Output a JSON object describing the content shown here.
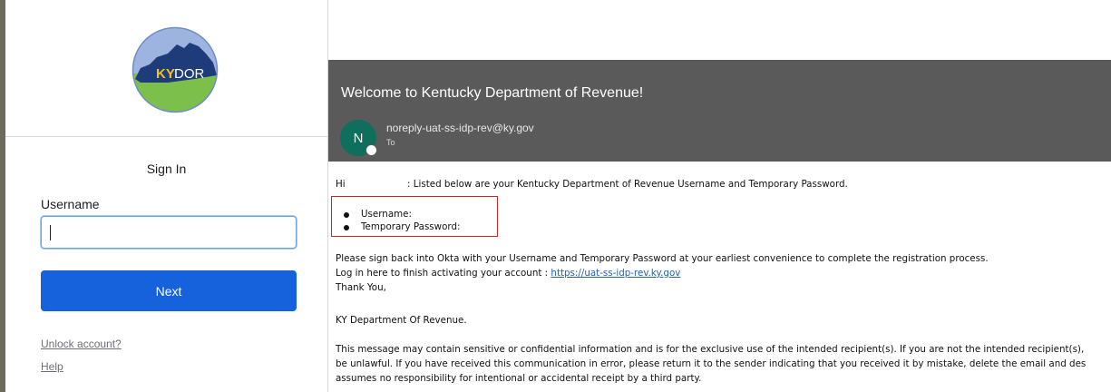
{
  "signin": {
    "logo_text_ky": "KY",
    "logo_text_dor": "DOR",
    "title": "Sign In",
    "username_label": "Username",
    "username_value": "",
    "next_label": "Next",
    "unlock_label": "Unlock account?",
    "help_label": "Help"
  },
  "email": {
    "subject": "Welcome to Kentucky Department of Revenue!",
    "avatar_letter": "N",
    "sender": "noreply-uat-ss-idp-rev@ky.gov",
    "to_label": "To",
    "greeting_hi": "Hi",
    "greeting_text": ": Listed below are your Kentucky Department of Revenue Username and Temporary Password.",
    "credentials": [
      "Username:",
      "Temporary Password:"
    ],
    "para_1": "Please sign back into Okta with your Username and Temporary Password at your earliest convenience to complete the registration process.",
    "para_2_prefix": "Log in here to finish activating your account : ",
    "para_2_link": "https://uat-ss-idp-rev.ky.gov",
    "thanks": "Thank You,",
    "signature": "KY Department Of Revenue.",
    "disclaimer_1": "This message may contain sensitive or confidential information and is for the exclusive use of the intended recipient(s). If you are not the intended recipient(s),",
    "disclaimer_2": "be unlawful. If you have received this communication in error, please return it to the sender indicating that you received it by mistake, delete the email and des",
    "disclaimer_3": "assumes no responsibility for intentional or accidental receipt by a third party."
  },
  "colors": {
    "primary_button": "#1662dd",
    "email_header": "#5a5a5a",
    "avatar": "#0f6e5c",
    "highlight_box": "#c62828",
    "link": "#1f5fbf"
  }
}
